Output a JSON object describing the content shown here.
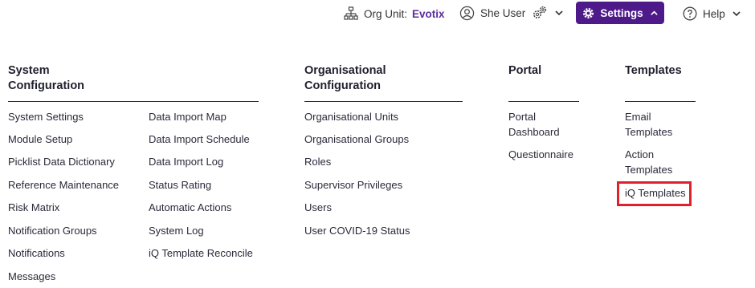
{
  "topbar": {
    "org_unit_label": "Org Unit:",
    "org_unit_value": "Evotix",
    "user_name": "She User",
    "settings_label": "Settings",
    "help_label": "Help"
  },
  "menu": {
    "system_configuration": {
      "heading_line1": "System",
      "heading_line2": "Configuration",
      "col1": [
        "System Settings",
        "Module Setup",
        "Picklist Data Dictionary",
        "Reference Maintenance",
        "Risk Matrix",
        "Notification Groups",
        "Notifications",
        "Messages"
      ],
      "col2": [
        "Data Import Map",
        "Data Import Schedule",
        "Data Import Log",
        "Status Rating",
        "Automatic Actions",
        "System Log",
        "iQ Template Reconcile"
      ]
    },
    "organisational_configuration": {
      "heading_line1": "Organisational",
      "heading_line2": "Configuration",
      "items": [
        "Organisational Units",
        "Organisational Groups",
        "Roles",
        "Supervisor Privileges",
        "Users",
        "User COVID-19 Status"
      ]
    },
    "portal": {
      "heading": "Portal",
      "dashboard_line1": "Portal",
      "dashboard_line2": "Dashboard",
      "questionnaire": "Questionnaire"
    },
    "templates": {
      "heading": "Templates",
      "email_line1": "Email",
      "email_line2": "Templates",
      "action_line1": "Action",
      "action_line2": "Templates",
      "iq": "iQ Templates"
    }
  },
  "colors": {
    "accent": "#4e1a8a",
    "org_unit_value": "#5b2c9a",
    "highlight": "#e0202a"
  },
  "icons": [
    "org-tree-icon",
    "user-circle-icon",
    "gears-icon",
    "chevron-down-icon",
    "settings-gear-icon",
    "chevron-up-icon",
    "help-circle-icon"
  ]
}
